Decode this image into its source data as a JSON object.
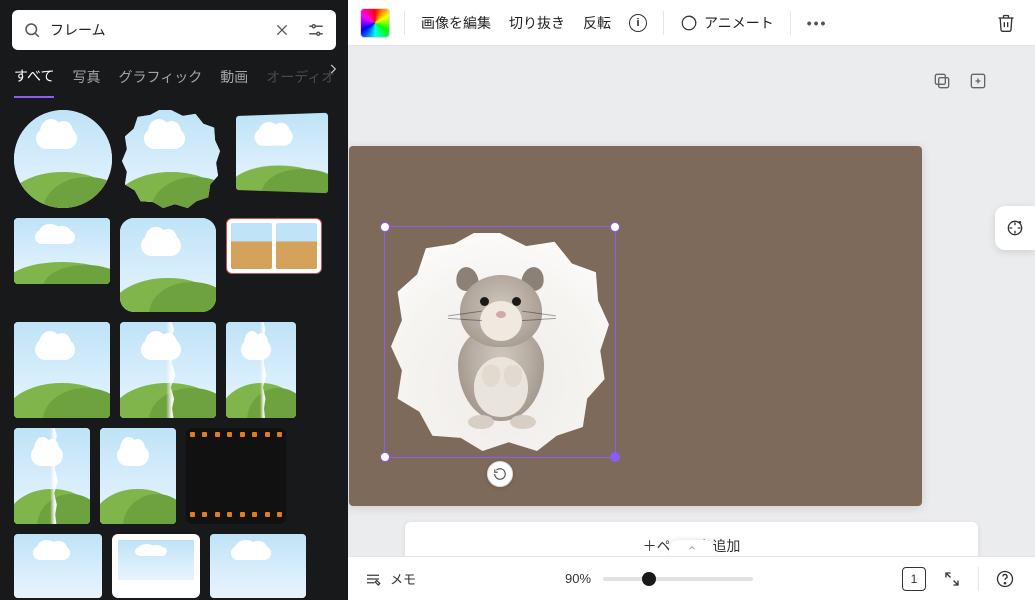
{
  "search": {
    "value": "フレーム"
  },
  "tabs": {
    "items": [
      {
        "label": "すべて",
        "active": true
      },
      {
        "label": "写真"
      },
      {
        "label": "グラフィック"
      },
      {
        "label": "動画"
      },
      {
        "label": "オーディオ",
        "faded": true
      }
    ]
  },
  "toolbar": {
    "edit_image": "画像を編集",
    "crop": "切り抜き",
    "flip": "反転",
    "animate": "アニメート"
  },
  "canvas": {
    "add_page": "＋ページを追加",
    "background_color": "#7d6a5b",
    "selection_color": "#8b5cf6"
  },
  "bottombar": {
    "notes": "メモ",
    "zoom_label": "90%",
    "zoom_value": 90,
    "page_count": "1"
  }
}
